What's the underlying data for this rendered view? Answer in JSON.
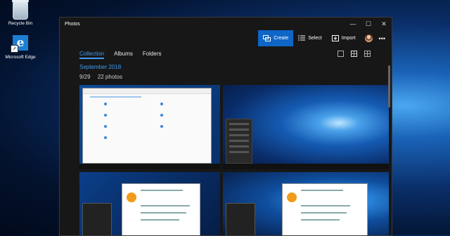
{
  "desktop": {
    "icons": [
      {
        "label": "Recycle Bin",
        "icon": "recycle-bin-icon"
      },
      {
        "label": "Microsoft Edge",
        "icon": "edge-icon"
      }
    ]
  },
  "window": {
    "title": "Photos",
    "controls": {
      "minimize": "—",
      "maximize": "☐",
      "close": "✕"
    }
  },
  "toolbar": {
    "create_label": "Create",
    "select_label": "Select",
    "import_label": "Import",
    "more_label": "•••",
    "accent": "#0e66c7"
  },
  "nav": {
    "tabs": [
      {
        "label": "Collection",
        "active": true
      },
      {
        "label": "Albums",
        "active": false
      },
      {
        "label": "Folders",
        "active": false
      }
    ]
  },
  "content": {
    "month": "September 2018",
    "date": "9/29",
    "count": "22 photos"
  }
}
